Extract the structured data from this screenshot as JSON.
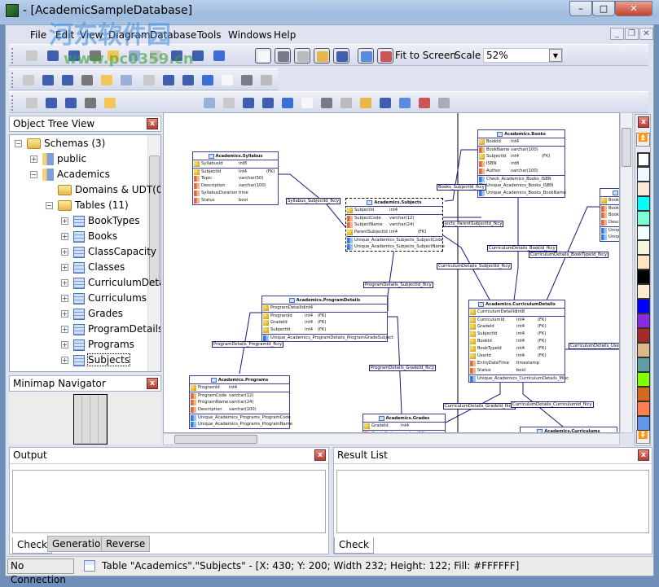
{
  "window": {
    "title": "- [AcademicSampleDatabase]",
    "minimize": "–",
    "maximize": "□",
    "close": "✕"
  },
  "watermark": {
    "text": "河东软件园",
    "url": "www.pc0359.cn"
  },
  "menu": [
    "File",
    "Edit",
    "View",
    "Diagram",
    "Database",
    "Tools",
    "Windows",
    "Help"
  ],
  "mdi_buttons": {
    "minimize": "_",
    "restore": "❐",
    "close": "✕"
  },
  "toolbar1": {
    "icons": [
      "new-icon",
      "open-icon",
      "save-icon",
      "print-icon",
      "copy-icon",
      "cut-icon",
      "paste-icon",
      "undo-icon",
      "redo-icon",
      "help-icon",
      "layout-1-icon",
      "layout-2-icon",
      "layout-3-icon",
      "layout-4-icon",
      "layout-5-icon",
      "grid-icon",
      "pin-icon"
    ],
    "fit_label": "Fit to Screen",
    "scale_label": "Scale",
    "scale_value": "52%"
  },
  "toolbar2": {
    "icons": [
      "pointer-icon",
      "move-icon",
      "delete-icon",
      "hand-icon",
      "zoom-in-icon",
      "zoom-out-icon",
      "table-icon",
      "relation-icon",
      "relation-many-icon",
      "text-icon",
      "view-icon",
      "note-icon",
      "image-icon"
    ]
  },
  "toolbar3": {
    "icons": [
      "check-model-icon",
      "report-icon",
      "compare-icon",
      "find-icon",
      "validate-icon",
      "align-left-icon",
      "align-top-icon",
      "grid-cells-icon",
      "grid-columns-icon",
      "color-icon",
      "import-icon",
      "note-add-icon",
      "export-icon",
      "table-grid-icon",
      "database-icon",
      "users-icon",
      "pointer-select-icon",
      "key-icon"
    ]
  },
  "object_tree": {
    "title": "Object Tree View",
    "nodes": [
      {
        "label": "Schemas (3)",
        "expander": "−",
        "icon": "folder-icon",
        "level": 0
      },
      {
        "label": "public",
        "expander": "+",
        "icon": "schema-icon",
        "level": 1
      },
      {
        "label": "Academics",
        "expander": "−",
        "icon": "schema-icon",
        "level": 1
      },
      {
        "label": "Domains & UDT(0)",
        "expander": "",
        "icon": "folder-icon",
        "level": 2
      },
      {
        "label": "Tables (11)",
        "expander": "−",
        "icon": "folder-icon",
        "level": 2
      },
      {
        "label": "BookTypes",
        "expander": "+",
        "icon": "table-icon",
        "level": 3
      },
      {
        "label": "Books",
        "expander": "+",
        "icon": "table-icon",
        "level": 3
      },
      {
        "label": "ClassCapacity",
        "expander": "+",
        "icon": "table-icon",
        "level": 3
      },
      {
        "label": "Classes",
        "expander": "+",
        "icon": "table-icon",
        "level": 3
      },
      {
        "label": "CurriculumDeta",
        "expander": "+",
        "icon": "table-icon",
        "level": 3
      },
      {
        "label": "Curriculums",
        "expander": "+",
        "icon": "table-icon",
        "level": 3
      },
      {
        "label": "Grades",
        "expander": "+",
        "icon": "table-icon",
        "level": 3
      },
      {
        "label": "ProgramDetails",
        "expander": "+",
        "icon": "table-icon",
        "level": 3
      },
      {
        "label": "Programs",
        "expander": "+",
        "icon": "table-icon",
        "level": 3
      },
      {
        "label": "Subjects",
        "expander": "+",
        "icon": "table-icon",
        "level": 3,
        "selected": true
      }
    ]
  },
  "minimap": {
    "title": "Minimap Navigator"
  },
  "diagram": {
    "tables": [
      {
        "id": "syllabus",
        "name": "Academics.Syllabus",
        "columns": [
          [
            "pk",
            "SyllabusId",
            "int8",
            ""
          ],
          [
            "pk",
            "SubjectId",
            "int4",
            "(FK)"
          ],
          [
            "col",
            "Topic",
            "varchar(50)",
            ""
          ],
          [
            "col",
            "Description",
            "varchar(100)",
            ""
          ],
          [
            "col",
            "SyllabusDuration",
            "time",
            ""
          ],
          [
            "col",
            "Status",
            "bool",
            ""
          ]
        ],
        "constraints": []
      },
      {
        "id": "subjects",
        "name": "Academics.Subjects",
        "selected": true,
        "columns": [
          [
            "pk",
            "SubjectId",
            "int4",
            ""
          ],
          [
            "col",
            "SubjectCode",
            "varchar(12)",
            ""
          ],
          [
            "col",
            "SubjectName",
            "varchar(24)",
            ""
          ],
          [
            "pk",
            "ParentSubjectId",
            "int4",
            "(FK)"
          ]
        ],
        "constraints": [
          "Unique_Academics_Subjects_SubjectCode",
          "Unique_Academics_Subjects_SubjectName"
        ]
      },
      {
        "id": "books",
        "name": "Academics.Books",
        "columns": [
          [
            "pk",
            "BookId",
            "int4",
            ""
          ],
          [
            "col",
            "BookName",
            "varchar(100)",
            ""
          ],
          [
            "pk",
            "SubjectId",
            "int4",
            "(FK)"
          ],
          [
            "col",
            "ISBN",
            "int8",
            ""
          ],
          [
            "col",
            "Author",
            "varchar(100)",
            ""
          ]
        ],
        "constraints": [
          "Check_Academics_Books_ISBN",
          "Unique_Academics_Books_ISBN",
          "Unique_Academics_Books_BookName"
        ]
      },
      {
        "id": "booktypes",
        "name": "",
        "columns": [
          [
            "pk",
            "BookT",
            "",
            ""
          ],
          [
            "col",
            "BookT",
            "",
            ""
          ],
          [
            "col",
            "BookT",
            "",
            ""
          ],
          [
            "col",
            "Descri",
            "",
            ""
          ]
        ],
        "constraints": [
          "Uniqu",
          "Uniqu"
        ]
      },
      {
        "id": "programdetails",
        "name": "Academics.ProgramDetails",
        "columns": [
          [
            "pk",
            "ProgramDetailId",
            "int4",
            ""
          ],
          [
            "pk",
            "ProgramId",
            "int4",
            "(FK)"
          ],
          [
            "pk",
            "GradeId",
            "int4",
            "(FK)"
          ],
          [
            "pk",
            "SubjectId",
            "int4",
            "(FK)"
          ]
        ],
        "constraints": [
          "Unique_Academics_ProgramDetails_ProgramGradeSubject"
        ]
      },
      {
        "id": "programs",
        "name": "Academics.Programs",
        "columns": [
          [
            "pk",
            "ProgramId",
            "int4",
            ""
          ],
          [
            "col",
            "ProgramCode",
            "varchar(12)",
            ""
          ],
          [
            "col",
            "ProgramName",
            "varchar(24)",
            ""
          ],
          [
            "col",
            "Description",
            "varchar(100)",
            ""
          ]
        ],
        "constraints": [
          "Unique_Academics_Programs_ProgramCode",
          "Unique_Academics_Programs_ProgramName"
        ]
      },
      {
        "id": "grades",
        "name": "Academics.Grades",
        "columns": [
          [
            "pk",
            "GradeId",
            "int4",
            ""
          ],
          [
            "col",
            "GradeCode",
            "varchar(12)",
            ""
          ]
        ],
        "constraints": []
      },
      {
        "id": "curriculumdetails",
        "name": "Academics.CurriculumDetails",
        "columns": [
          [
            "pk",
            "CurriculumDetailId",
            "int8",
            ""
          ],
          [
            "pk",
            "CurriculumId",
            "int4",
            "(FK)"
          ],
          [
            "pk",
            "GradeId",
            "int4",
            "(FK)"
          ],
          [
            "pk",
            "SubjectId",
            "int4",
            "(FK)"
          ],
          [
            "pk",
            "BookId",
            "int4",
            "(FK)"
          ],
          [
            "pk",
            "BookTypeId",
            "int4",
            "(FK)"
          ],
          [
            "pk",
            "UserId",
            "int4",
            "(FK)"
          ],
          [
            "col",
            "EntryDateTime",
            "timestamp",
            ""
          ],
          [
            "col",
            "Status",
            "bool",
            ""
          ]
        ],
        "constraints": [
          "Unique_Academics_CurriculumDetails_Misc"
        ]
      },
      {
        "id": "curriculums",
        "name": "Academics.Curriculums",
        "columns": [],
        "constraints": []
      }
    ],
    "relations": [
      "Syllabus_SubjectId_fkcy",
      "Books_SubjectId_fkcy",
      "jects_ParentSubjectId_fkcy",
      "CurriculumDetails_BookId_fkcy",
      "CurriculumDetails_BookTypeId_fkcy",
      "CurriculumDetails_SubjectId_fkcy",
      "ProgramDetails_SubjectId_fkcy",
      "ProgramDetails_ProgramId_fkcy",
      "ProgramDetails_GradeId_fkcy",
      "CurriculumDetails_UserId_f",
      "CurriculumDetails_GradeId_fkcy",
      "CurriculumDetails_CurriculumId_fkcy"
    ]
  },
  "palette": [
    "#FFFFFF",
    "#F0F8FF",
    "#FAEBD7",
    "#00FFFF",
    "#7FFFD4",
    "#F0FFFF",
    "#F5F5DC",
    "#FFE4C4",
    "#000000",
    "#FFEBCD",
    "#0000FF",
    "#8A2BE2",
    "#A52A2A",
    "#DEB887",
    "#5F9EA0",
    "#7FFF00",
    "#D2691E",
    "#FF7F50",
    "#6495ED"
  ],
  "output": {
    "title": "Output",
    "tabs": [
      "Check",
      "Generation",
      "Reverse"
    ],
    "active_tab": "Check"
  },
  "result_list": {
    "title": "Result List",
    "tabs": [
      "Check"
    ]
  },
  "status": {
    "connection": "No Connection",
    "message": "Table \"Academics\".\"Subjects\" - [X: 430; Y: 200; Width 232; Height: 122; Fill: #FFFFFF]"
  }
}
